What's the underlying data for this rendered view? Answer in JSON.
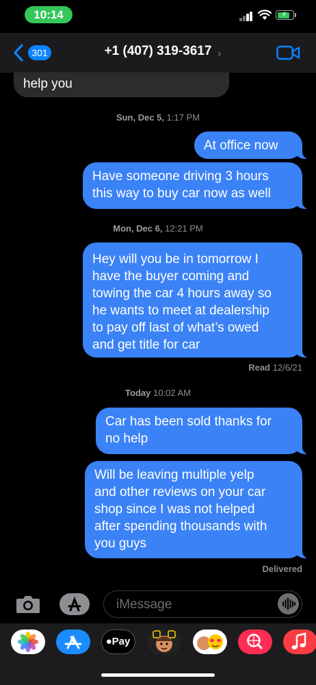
{
  "status_bar": {
    "time": "10:14"
  },
  "header": {
    "back_badge": "301",
    "contact": "+1 (407) 319-3617"
  },
  "thread": {
    "partial_incoming": "help you",
    "ts1_day": "Sun, Dec 5,",
    "ts1_time": "1:17 PM",
    "m1": "At office now",
    "m2_line1": "Have someone driving 3 hours",
    "m2_line2": "this way to buy car now as well",
    "ts2_day": "Mon, Dec 6,",
    "ts2_time": "12:21 PM",
    "m3_lines": [
      "Hey will you be in tomorrow I",
      "have the buyer coming and",
      "towing the car 4 hours away so",
      "he wants to meet at dealership",
      "to pay off last of what’s owed",
      "and get title for car"
    ],
    "read_label": "Read",
    "read_date": "12/6/21",
    "ts3_day": "Today",
    "ts3_time": "10:02 AM",
    "m4_lines": [
      "Car has been sold thanks for",
      "no help"
    ],
    "m5_lines": [
      "Will be leaving multiple yelp",
      "and other reviews on your car",
      "shop since I was not helped",
      "after spending thousands with",
      "you guys"
    ],
    "delivered": "Delivered"
  },
  "input": {
    "placeholder": "iMessage"
  },
  "drawer": {
    "apps": [
      "photos-app",
      "app-store-app",
      "apple-pay-app",
      "memoji-app",
      "memoji-stickers-app",
      "web-search-app",
      "music-app"
    ],
    "apple_pay_label": "Pay"
  },
  "colors": {
    "outgoing_bubble": "#3b82f6",
    "incoming_bubble": "#2c2c2e",
    "accent": "#0a84ff",
    "time_pill": "#34c759"
  }
}
